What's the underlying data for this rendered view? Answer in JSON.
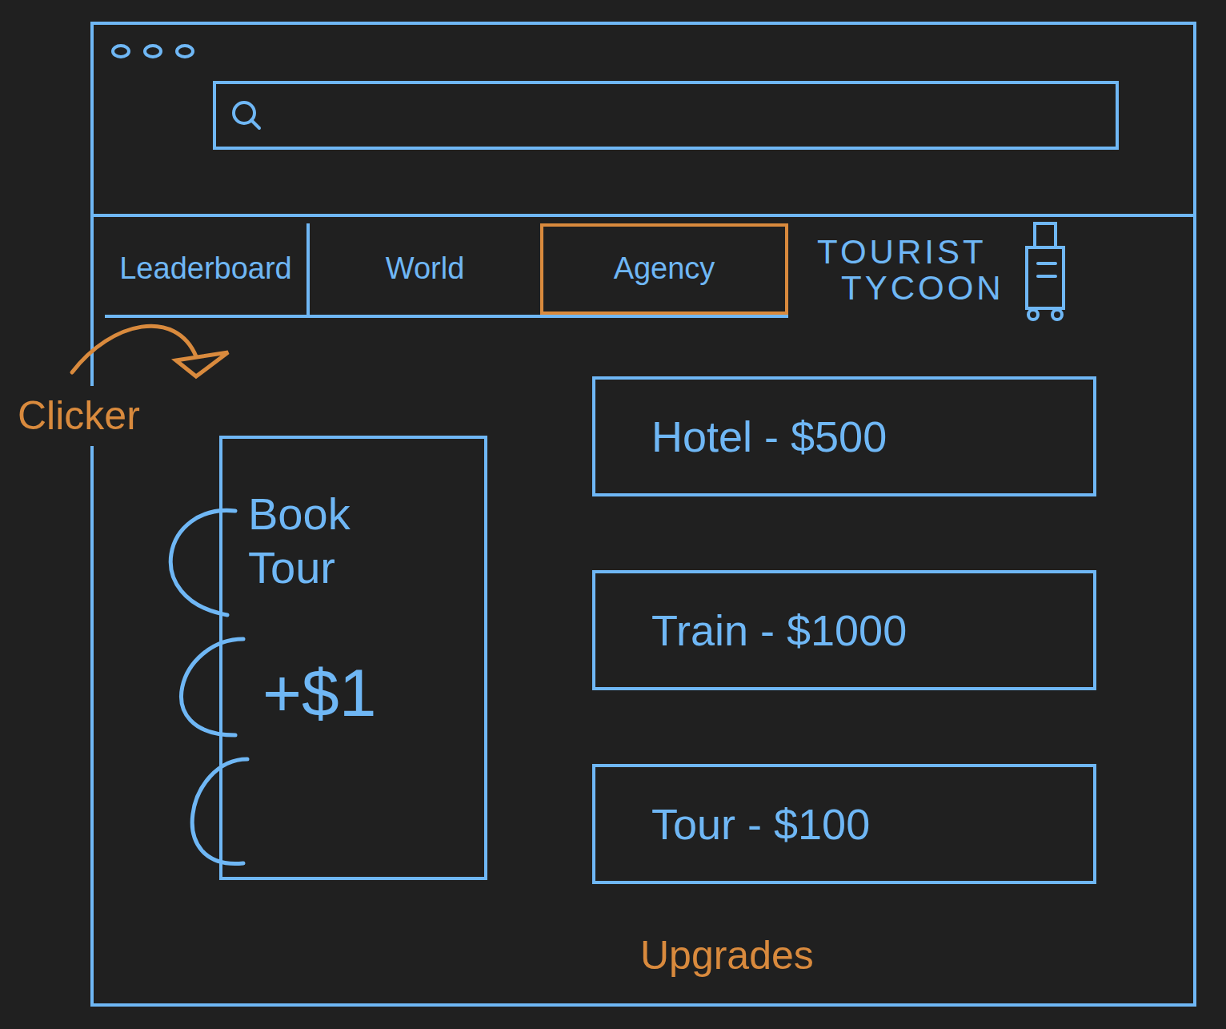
{
  "window": {
    "controls": 3
  },
  "tabs": [
    {
      "label": "Leaderboard",
      "selected": false
    },
    {
      "label": "World",
      "selected": false
    },
    {
      "label": "Agency",
      "selected": true
    }
  ],
  "app_title": {
    "lines": [
      "TOURIST",
      "TYCOON"
    ]
  },
  "clicker": {
    "label": "Book Tour",
    "reward": "+$1"
  },
  "upgrades": [
    {
      "label": "Hotel - $500"
    },
    {
      "label": "Train - $1000"
    },
    {
      "label": "Tour - $100"
    }
  ],
  "annotations": {
    "clicker": "Clicker",
    "upgrades": "Upgrades"
  }
}
